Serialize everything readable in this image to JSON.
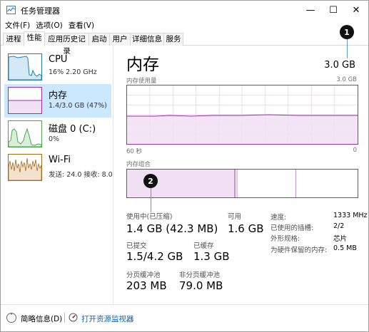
{
  "window": {
    "title": "任务管理器",
    "minimize_glyph": "—",
    "maximize_glyph": "☐",
    "close_glyph": "✕"
  },
  "menu": [
    "文件(F)",
    "选项(O)",
    "查看(V)"
  ],
  "tabs": [
    {
      "label": "进程"
    },
    {
      "label": "性能"
    },
    {
      "label": "应用历史记录"
    },
    {
      "label": "启动"
    },
    {
      "label": "用户"
    },
    {
      "label": "详细信息"
    },
    {
      "label": "服务"
    }
  ],
  "active_tab": "性能",
  "sidebar": [
    {
      "name": "CPU",
      "detail": "16% 2.20 GHz",
      "icon": "cpu-graph-icon"
    },
    {
      "name": "内存",
      "detail": "1.4/3.0 GB (47%)",
      "icon": "memory-graph-icon",
      "selected": true
    },
    {
      "name": "磁盘 0 (C:)",
      "detail": "0%",
      "icon": "disk-graph-icon"
    },
    {
      "name": "Wi-Fi",
      "detail": "发送: 24.0  接收: 8.0",
      "icon": "wifi-graph-icon"
    }
  ],
  "main": {
    "title": "内存",
    "capacity": "3.0 GB",
    "usage_label": "内存使用量",
    "usage_max": "3.0 GB",
    "time_left": "60 秒",
    "time_right": "0",
    "composition_label": "内存组合",
    "stats": {
      "in_use_label": "使用中(已压缩)",
      "in_use_value": "1.4 GB (42.3 MB)",
      "available_label": "可用",
      "available_value": "1.6 GB",
      "committed_label": "已提交",
      "committed_value": "1.5/4.2 GB",
      "cached_label": "已缓存",
      "cached_value": "1.3 GB",
      "paged_label": "分页缓冲池",
      "paged_value": "203 MB",
      "nonpaged_label": "非分页缓冲池",
      "nonpaged_value": "79.0 MB"
    },
    "details": [
      {
        "label": "速度:",
        "value": "1333 MHz"
      },
      {
        "label": "已使用的插槽:",
        "value": "2/2"
      },
      {
        "label": "外形规格:",
        "value": "芯片"
      },
      {
        "label": "为硬件保留的内存:",
        "value": "0.5 MB"
      }
    ]
  },
  "markers": [
    "1",
    "2"
  ],
  "footer": {
    "fewer_details": "简略信息(D)",
    "open_monitor": "打开资源监视器"
  },
  "colors": {
    "memory": "#9b2fae",
    "cpu": "#1a7ec7",
    "disk": "#4ca64c",
    "wifi": "#a8691a",
    "selected_bg": "#cce8ff"
  }
}
